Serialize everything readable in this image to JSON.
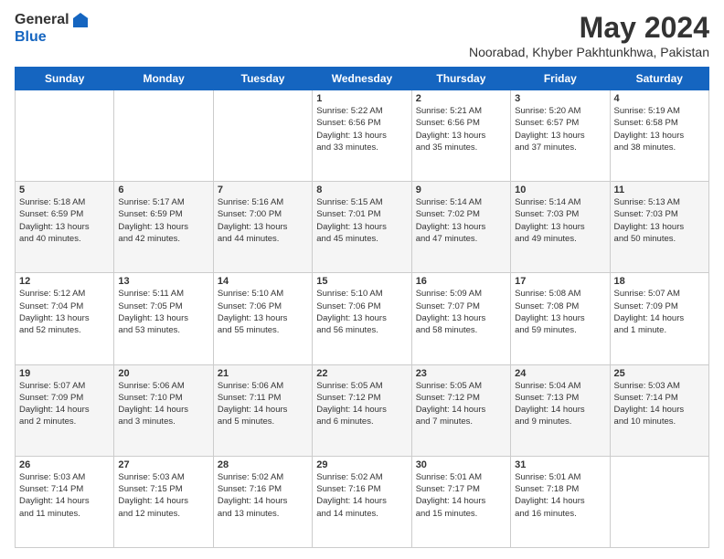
{
  "header": {
    "logo_general": "General",
    "logo_blue": "Blue",
    "month_title": "May 2024",
    "location": "Noorabad, Khyber Pakhtunkhwa, Pakistan"
  },
  "days_of_week": [
    "Sunday",
    "Monday",
    "Tuesday",
    "Wednesday",
    "Thursday",
    "Friday",
    "Saturday"
  ],
  "weeks": [
    [
      {
        "day": "",
        "info": ""
      },
      {
        "day": "",
        "info": ""
      },
      {
        "day": "",
        "info": ""
      },
      {
        "day": "1",
        "info": "Sunrise: 5:22 AM\nSunset: 6:56 PM\nDaylight: 13 hours\nand 33 minutes."
      },
      {
        "day": "2",
        "info": "Sunrise: 5:21 AM\nSunset: 6:56 PM\nDaylight: 13 hours\nand 35 minutes."
      },
      {
        "day": "3",
        "info": "Sunrise: 5:20 AM\nSunset: 6:57 PM\nDaylight: 13 hours\nand 37 minutes."
      },
      {
        "day": "4",
        "info": "Sunrise: 5:19 AM\nSunset: 6:58 PM\nDaylight: 13 hours\nand 38 minutes."
      }
    ],
    [
      {
        "day": "5",
        "info": "Sunrise: 5:18 AM\nSunset: 6:59 PM\nDaylight: 13 hours\nand 40 minutes."
      },
      {
        "day": "6",
        "info": "Sunrise: 5:17 AM\nSunset: 6:59 PM\nDaylight: 13 hours\nand 42 minutes."
      },
      {
        "day": "7",
        "info": "Sunrise: 5:16 AM\nSunset: 7:00 PM\nDaylight: 13 hours\nand 44 minutes."
      },
      {
        "day": "8",
        "info": "Sunrise: 5:15 AM\nSunset: 7:01 PM\nDaylight: 13 hours\nand 45 minutes."
      },
      {
        "day": "9",
        "info": "Sunrise: 5:14 AM\nSunset: 7:02 PM\nDaylight: 13 hours\nand 47 minutes."
      },
      {
        "day": "10",
        "info": "Sunrise: 5:14 AM\nSunset: 7:03 PM\nDaylight: 13 hours\nand 49 minutes."
      },
      {
        "day": "11",
        "info": "Sunrise: 5:13 AM\nSunset: 7:03 PM\nDaylight: 13 hours\nand 50 minutes."
      }
    ],
    [
      {
        "day": "12",
        "info": "Sunrise: 5:12 AM\nSunset: 7:04 PM\nDaylight: 13 hours\nand 52 minutes."
      },
      {
        "day": "13",
        "info": "Sunrise: 5:11 AM\nSunset: 7:05 PM\nDaylight: 13 hours\nand 53 minutes."
      },
      {
        "day": "14",
        "info": "Sunrise: 5:10 AM\nSunset: 7:06 PM\nDaylight: 13 hours\nand 55 minutes."
      },
      {
        "day": "15",
        "info": "Sunrise: 5:10 AM\nSunset: 7:06 PM\nDaylight: 13 hours\nand 56 minutes."
      },
      {
        "day": "16",
        "info": "Sunrise: 5:09 AM\nSunset: 7:07 PM\nDaylight: 13 hours\nand 58 minutes."
      },
      {
        "day": "17",
        "info": "Sunrise: 5:08 AM\nSunset: 7:08 PM\nDaylight: 13 hours\nand 59 minutes."
      },
      {
        "day": "18",
        "info": "Sunrise: 5:07 AM\nSunset: 7:09 PM\nDaylight: 14 hours\nand 1 minute."
      }
    ],
    [
      {
        "day": "19",
        "info": "Sunrise: 5:07 AM\nSunset: 7:09 PM\nDaylight: 14 hours\nand 2 minutes."
      },
      {
        "day": "20",
        "info": "Sunrise: 5:06 AM\nSunset: 7:10 PM\nDaylight: 14 hours\nand 3 minutes."
      },
      {
        "day": "21",
        "info": "Sunrise: 5:06 AM\nSunset: 7:11 PM\nDaylight: 14 hours\nand 5 minutes."
      },
      {
        "day": "22",
        "info": "Sunrise: 5:05 AM\nSunset: 7:12 PM\nDaylight: 14 hours\nand 6 minutes."
      },
      {
        "day": "23",
        "info": "Sunrise: 5:05 AM\nSunset: 7:12 PM\nDaylight: 14 hours\nand 7 minutes."
      },
      {
        "day": "24",
        "info": "Sunrise: 5:04 AM\nSunset: 7:13 PM\nDaylight: 14 hours\nand 9 minutes."
      },
      {
        "day": "25",
        "info": "Sunrise: 5:03 AM\nSunset: 7:14 PM\nDaylight: 14 hours\nand 10 minutes."
      }
    ],
    [
      {
        "day": "26",
        "info": "Sunrise: 5:03 AM\nSunset: 7:14 PM\nDaylight: 14 hours\nand 11 minutes."
      },
      {
        "day": "27",
        "info": "Sunrise: 5:03 AM\nSunset: 7:15 PM\nDaylight: 14 hours\nand 12 minutes."
      },
      {
        "day": "28",
        "info": "Sunrise: 5:02 AM\nSunset: 7:16 PM\nDaylight: 14 hours\nand 13 minutes."
      },
      {
        "day": "29",
        "info": "Sunrise: 5:02 AM\nSunset: 7:16 PM\nDaylight: 14 hours\nand 14 minutes."
      },
      {
        "day": "30",
        "info": "Sunrise: 5:01 AM\nSunset: 7:17 PM\nDaylight: 14 hours\nand 15 minutes."
      },
      {
        "day": "31",
        "info": "Sunrise: 5:01 AM\nSunset: 7:18 PM\nDaylight: 14 hours\nand 16 minutes."
      },
      {
        "day": "",
        "info": ""
      }
    ]
  ]
}
